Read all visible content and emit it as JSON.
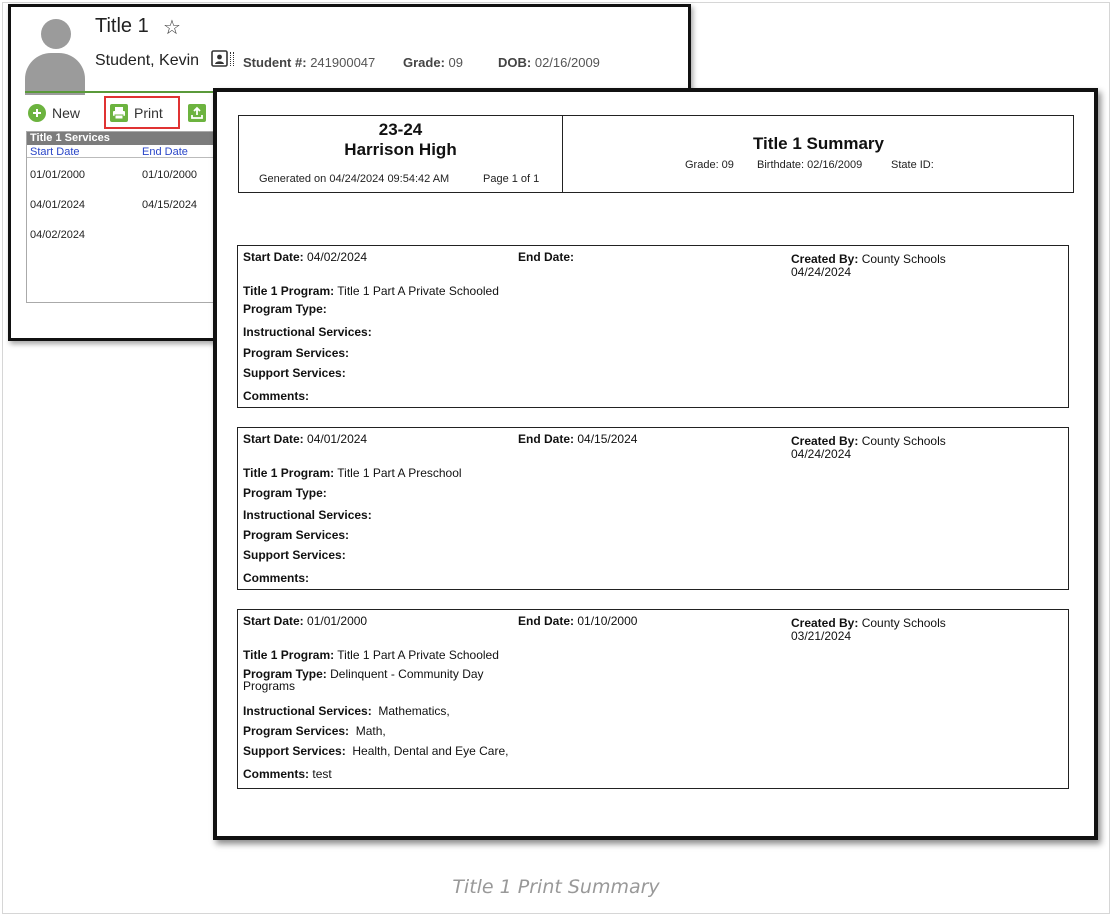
{
  "app": {
    "title": "Title 1",
    "student_name": "Student, Kevin",
    "student_num_label": "Student #:",
    "student_num": "241900047",
    "grade_label": "Grade:",
    "grade": "09",
    "dob_label": "DOB:",
    "dob": "02/16/2009",
    "toolbar": {
      "new_label": "New",
      "print_label": "Print"
    },
    "panel": {
      "title": "Title 1 Services",
      "columns": [
        "Start Date",
        "End Date"
      ],
      "rows": [
        {
          "start": "01/01/2000",
          "end": "01/10/2000"
        },
        {
          "start": "04/01/2024",
          "end": "04/15/2024"
        },
        {
          "start": "04/02/2024",
          "end": ""
        }
      ]
    }
  },
  "report": {
    "school_year": "23-24",
    "school_name": "Harrison High",
    "generated": "Generated on 04/24/2024 09:54:42 AM",
    "page": "Page 1 of 1",
    "title": "Title 1 Summary",
    "grade": "Grade: 09",
    "birthdate": "Birthdate: 02/16/2009",
    "state_id": "State ID:",
    "labels": {
      "start_date": "Start Date:",
      "end_date": "End Date:",
      "created_by": "Created By:",
      "program": "Title 1 Program:",
      "program_type": "Program Type:",
      "instructional": "Instructional Services:",
      "program_services": "Program Services:",
      "support": "Support Services:",
      "comments": "Comments:"
    },
    "records": [
      {
        "start": "04/02/2024",
        "end": "",
        "created_by": "County Schools",
        "created_date": "04/24/2024",
        "program": "Title 1 Part A Private Schooled",
        "program_type": "",
        "instructional": "",
        "program_services": "",
        "support": "",
        "comments": ""
      },
      {
        "start": "04/01/2024",
        "end": "04/15/2024",
        "created_by": "County Schools",
        "created_date": "04/24/2024",
        "program": "Title 1 Part A Preschool",
        "program_type": "",
        "instructional": "",
        "program_services": "",
        "support": "",
        "comments": ""
      },
      {
        "start": "01/01/2000",
        "end": "01/10/2000",
        "created_by": "County Schools",
        "created_date": "03/21/2024",
        "program": "Title 1 Part A Private Schooled",
        "program_type": "Delinquent - Community Day Programs",
        "instructional": "Mathematics,",
        "program_services": "Math,",
        "support": "Health, Dental and Eye Care,",
        "comments": "test"
      }
    ]
  },
  "caption": "Title 1 Print Summary"
}
